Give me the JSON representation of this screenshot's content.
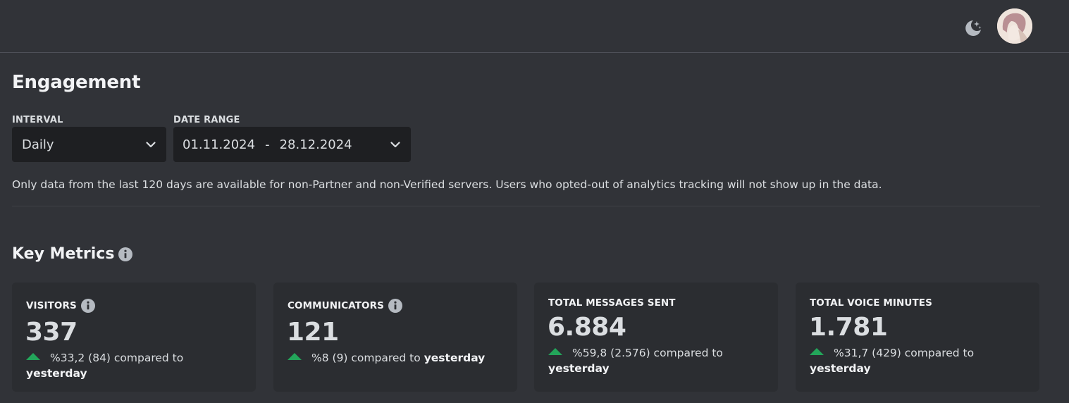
{
  "header": {
    "theme_icon": "moon-stars-icon",
    "avatar_icon": "user-avatar"
  },
  "page": {
    "title": "Engagement"
  },
  "filters": {
    "interval_label": "INTERVAL",
    "interval_value": "Daily",
    "date_range_label": "DATE RANGE",
    "date_start": "01.11.2024",
    "date_separator": "-",
    "date_end": "28.12.2024"
  },
  "notice": "Only data from the last 120 days are available for non-Partner and non-Verified servers. Users who opted-out of analytics tracking will not show up in the data.",
  "key_metrics": {
    "title": "Key Metrics",
    "cards": [
      {
        "title": "VISITORS",
        "value": "337",
        "change": "%33,2 (84) compared to",
        "compare": "yesterday"
      },
      {
        "title": "COMMUNICATORS",
        "value": "121",
        "change": "%8 (9) compared to",
        "compare": "yesterday"
      },
      {
        "title": "TOTAL MESSAGES SENT",
        "value": "6.884",
        "change": "%59,8 (2.576) compared to",
        "compare": "yesterday"
      },
      {
        "title": "TOTAL VOICE MINUTES",
        "value": "1.781",
        "change": "%31,7 (429) compared to",
        "compare": "yesterday"
      }
    ]
  },
  "colors": {
    "background": "#313338",
    "card": "#2b2d31",
    "input": "#1e1f22",
    "positive": "#23a55a"
  }
}
